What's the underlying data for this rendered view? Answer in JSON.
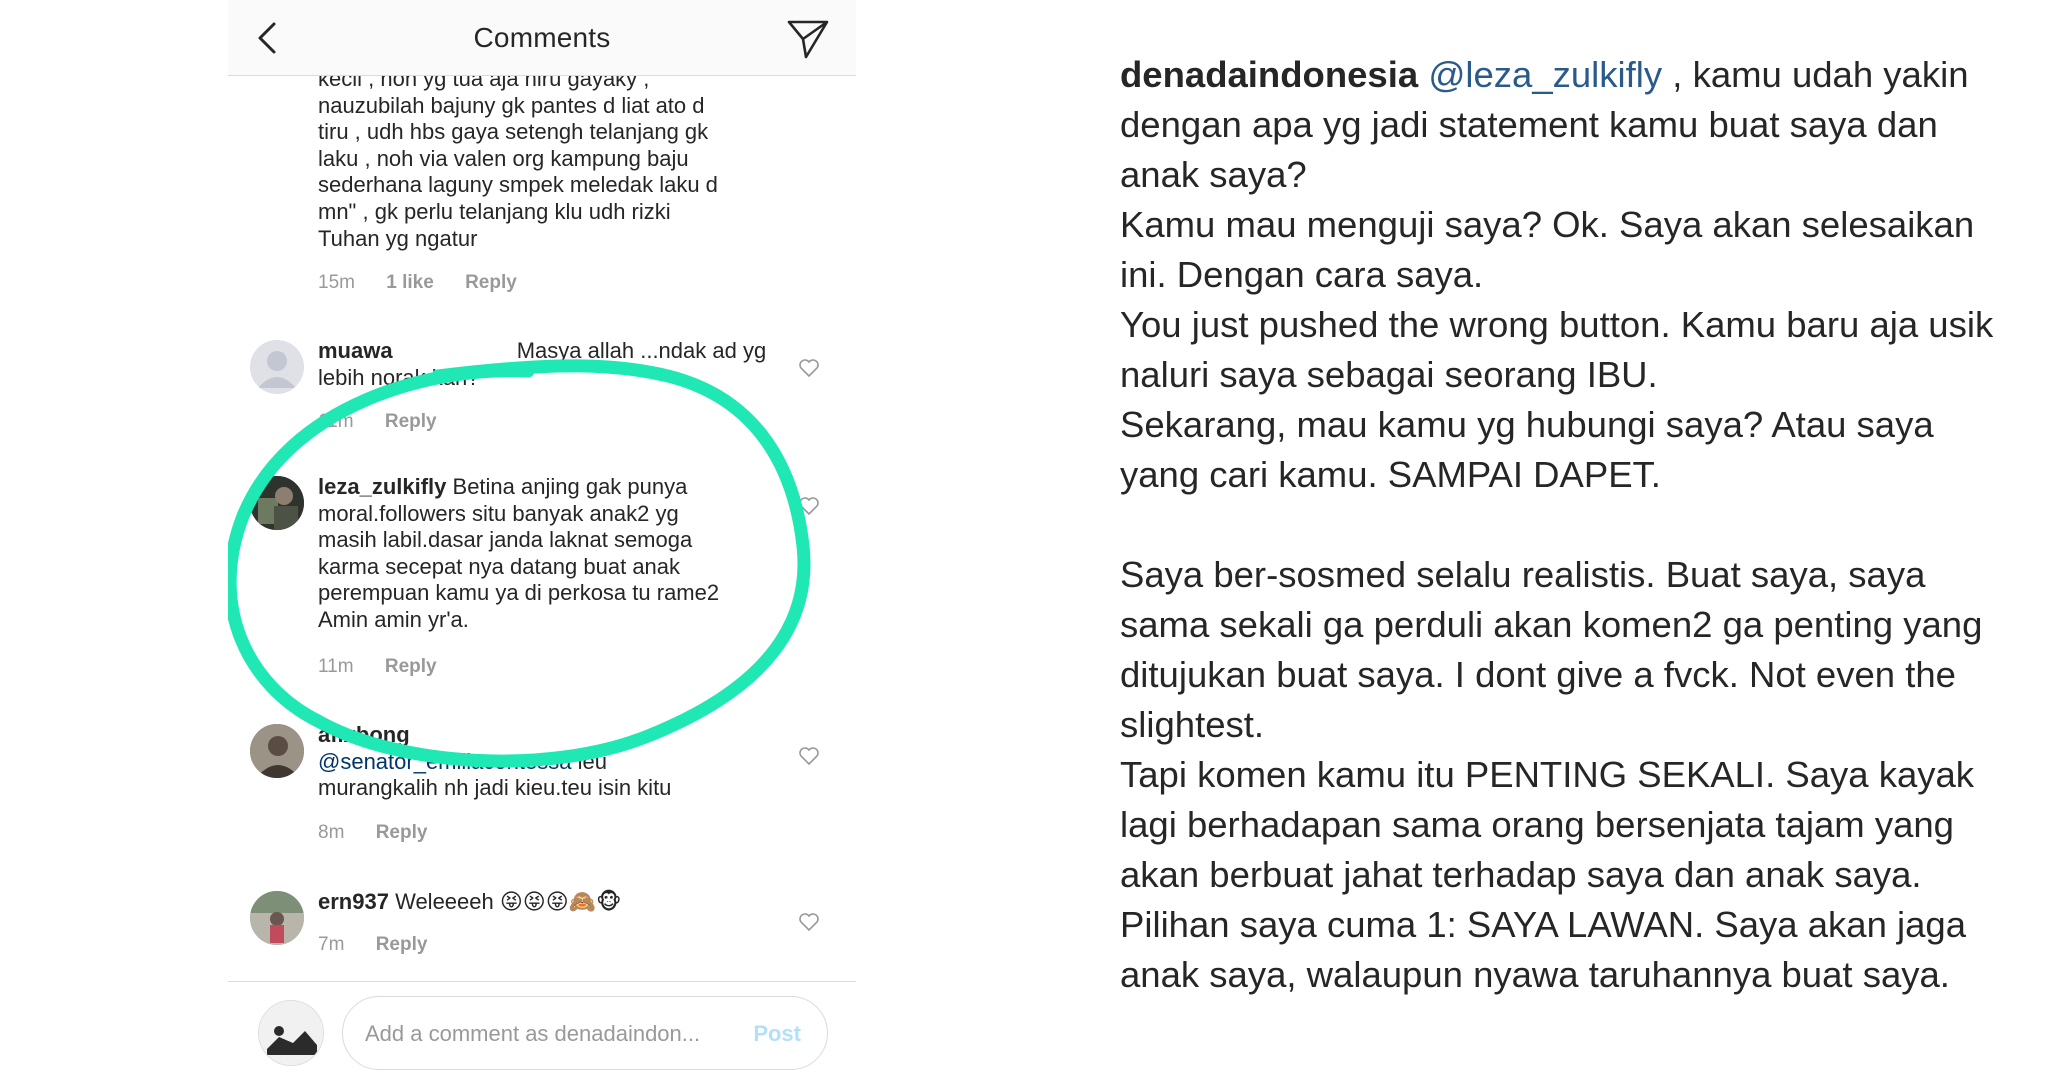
{
  "header": {
    "title": "Comments",
    "back_icon": "chevron-left-icon",
    "send_icon": "paper-plane-icon"
  },
  "comments": [
    {
      "id": "c1",
      "lines": [
        "kecil , noh yg tua aja niru gayaky ,",
        "nauzubilah bajuny gk pantes d liat ato d",
        "tiru , udh hbs gaya setengh telanjang gk",
        "laku , noh via valen org kampung baju",
        "sederhana laguny smpek meledak laku d",
        "mn\" , gk perlu telanjang klu udh rizki",
        "Tuhan yg ngatur"
      ],
      "time": "15m",
      "likes": "1 like",
      "reply": "Reply"
    },
    {
      "id": "c2",
      "username": "muawa",
      "lines_text": [
        "Masya allah ...ndak ad yg",
        "lebih norak kah?"
      ],
      "time": "11m",
      "reply": "Reply"
    },
    {
      "id": "c3",
      "username": "leza_zulkifly",
      "lines_text": [
        "Betina anjing gak punya",
        "moral.followers situ banyak anak2 yg",
        "masih labil.dasar janda laknat semoga",
        "karma secepat nya datang buat anak",
        "perempuan kamu ya di perkosa tu rame2",
        "Amin amin yr'a."
      ],
      "time": "11m",
      "reply": "Reply"
    },
    {
      "id": "c4",
      "username": "afixbong",
      "mention": "@senator_emiliacontessa",
      "lines_text": [
        "ieu",
        "murangkalih nh jadi kieu.teu isin kitu"
      ],
      "time": "8m",
      "reply": "Reply"
    },
    {
      "id": "c5",
      "username": "ern937",
      "lines_text": [
        "Weleeeeh 😝😝😝🙈🐵"
      ],
      "time": "7m",
      "reply": "Reply"
    }
  ],
  "composer": {
    "placeholder": "Add a comment as denadaindon...",
    "post_label": "Post"
  },
  "caption": {
    "username": "denadaindonesia",
    "mention": "@leza_zulkifly",
    "first_line_rest": " , kamu udah yakin",
    "lines": [
      "dengan apa yg jadi statement kamu buat saya dan",
      "anak saya?",
      "Kamu mau menguji saya? Ok. Saya akan selesaikan",
      "ini. Dengan cara saya.",
      "You just pushed the wrong button. Kamu baru aja usik",
      "naluri saya sebagai seorang IBU.",
      "Sekarang, mau kamu yg hubungi saya? Atau saya",
      "yang cari kamu. SAMPAI DAPET."
    ],
    "lines2": [
      "Saya ber-sosmed selalu realistis. Buat saya, saya",
      "sama sekali ga perduli akan komen2 ga penting yang",
      "ditujukan buat saya. I dont give a fvck. Not even the",
      "slightest.",
      "Tapi komen kamu itu PENTING SEKALI. Saya kayak",
      "lagi berhadapan sama orang bersenjata tajam yang",
      "akan berbuat jahat terhadap saya dan anak saya.",
      "Pilihan saya cuma 1: SAYA LAWAN. Saya akan jaga",
      "anak saya, walaupun nyawa taruhannya buat saya."
    ]
  },
  "colors": {
    "highlight_ring": "#1fe8b4",
    "mention": "#003569",
    "meta": "#999999"
  }
}
